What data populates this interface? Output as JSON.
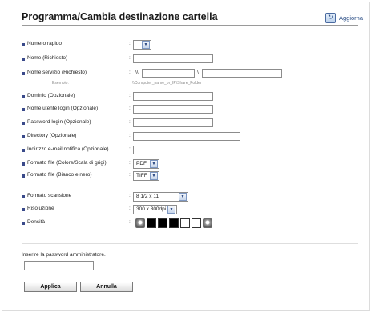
{
  "header": {
    "title": "Programma/Cambia destinazione cartella",
    "refresh_label": "Aggiorna",
    "refresh_icon": "refresh-icon"
  },
  "form": {
    "colon": ":",
    "rows": {
      "numero_rapido": {
        "label": "Numero rapido",
        "value": ""
      },
      "nome": {
        "label": "Nome (Richiesto)"
      },
      "nome_servizio": {
        "label": "Nome servizio (Richiesto)",
        "prefix": "\\\\",
        "separator": "\\"
      },
      "esempio": {
        "label": "Esempio:",
        "value": "\\\\Computer_name_or_IP\\Share_Folder"
      },
      "dominio": {
        "label": "Dominio (Opzionale)"
      },
      "nome_utente": {
        "label": "Nome utente login (Opzionale)"
      },
      "password_login": {
        "label": "Password login (Opzionale)"
      },
      "directory": {
        "label": "Directory (Opzionale)"
      },
      "indirizzo_email": {
        "label": "Indirizzo e-mail notifica (Opzionale)"
      },
      "formato_colore": {
        "label": "Formato file (Colore/Scala di grigi)",
        "value": "PDF"
      },
      "formato_bn": {
        "label": "Formato file (Bianco e nero)",
        "value": "TIFF"
      },
      "formato_scansione": {
        "label": "Formato scansione",
        "value": "8 1/2 x 11"
      },
      "risoluzione": {
        "label": "Risoluzione",
        "value": "300 x 300dpi"
      },
      "densita": {
        "label": "Densità",
        "level": 3,
        "levels": 7
      }
    },
    "colors": {
      "bullet": "#3a4a8a",
      "link": "#2b4e86"
    }
  },
  "admin": {
    "password_prompt": "Inserire la password amministratore.",
    "password_value": ""
  },
  "actions": {
    "apply_label": "Applica",
    "cancel_label": "Annulla"
  }
}
